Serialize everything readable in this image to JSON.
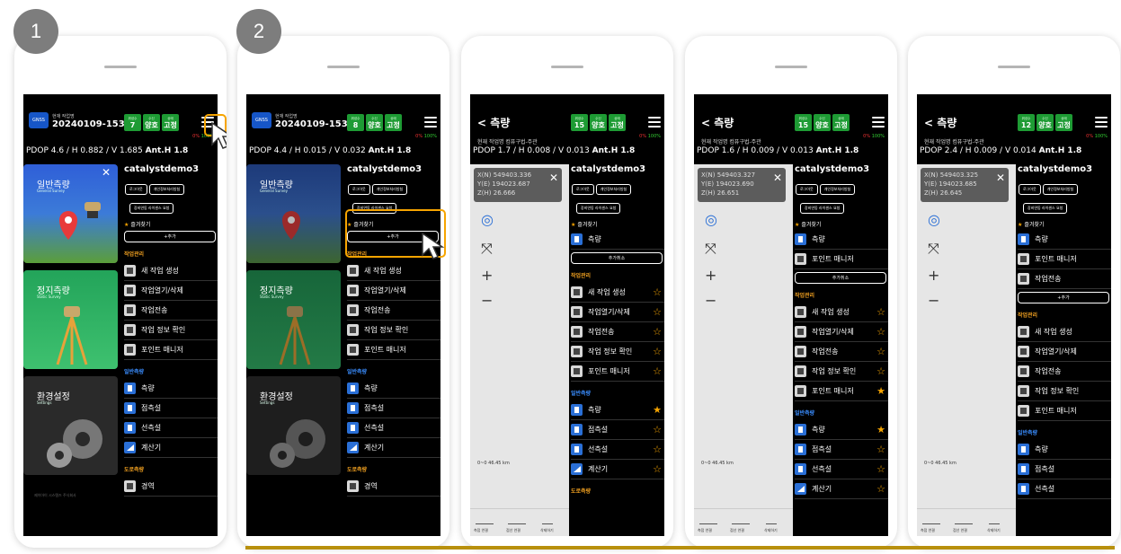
{
  "steps": [
    "1",
    "2"
  ],
  "status": {
    "badge_labels": [
      "위성수",
      "수신",
      "상태"
    ],
    "pdop_prefix": "PDOP",
    "anth_label": "Ant.H",
    "battery": "0%",
    "storage": "100%"
  },
  "phone1": {
    "work_label": "현재 작업명",
    "work_id": "20240109-153",
    "badges": [
      "7",
      "양호",
      "고정"
    ],
    "pdop": "PDOP 4.6 / H 0.882 / V 1.685",
    "anth": "Ant.H 1.8",
    "account": "catalystdemo3",
    "btns": [
      "로그아웃",
      "개인정보처리방침",
      "장비연동 라이센스 요청"
    ],
    "fav_title": "즐겨찾기",
    "fav_add": "+추가",
    "sec_work": "작업관리",
    "work_items": [
      "새 작업 생성",
      "작업열기/삭제",
      "작업전송",
      "작업 정보 확인",
      "포인트 매니저"
    ],
    "sec_general": "일반측량",
    "general_items": [
      "측량",
      "점측설",
      "선측설",
      "계산기"
    ],
    "sec_road": "도로측량",
    "road_items": [
      "경역"
    ],
    "tiles": [
      {
        "title": "일반측량",
        "sub": "General Survey"
      },
      {
        "title": "정지측량",
        "sub": "Static Survey"
      },
      {
        "title": "환경설정",
        "sub": "Settings"
      }
    ],
    "footer_note": "제이아이 시스템즈 주식회사"
  },
  "phone2": {
    "work_label": "현재 작업명",
    "work_id": "20240109-153",
    "badges": [
      "8",
      "양호",
      "고정"
    ],
    "pdop": "PDOP 4.4 / H 0.015 / V 0.032",
    "anth": "Ant.H 1.8",
    "account": "catalystdemo3",
    "btns": [
      "로그아웃",
      "개인정보처리방침",
      "장비연동 라이센스 요청"
    ],
    "fav_title": "즐겨찾기",
    "fav_add": "+추가",
    "sec_work": "작업관리",
    "work_items": [
      "새 작업 생성",
      "작업열기/삭제",
      "작업전송",
      "작업 정보 확인",
      "포인트 매니저"
    ],
    "sec_general": "일반측량",
    "general_items": [
      "측량",
      "점측설",
      "선측설",
      "계산기"
    ],
    "sec_road": "도로측량",
    "road_items": [
      "경역"
    ],
    "tiles": [
      {
        "title": "일반측량",
        "sub": "General Survey"
      },
      {
        "title": "정지측량",
        "sub": "Static Survey"
      },
      {
        "title": "환경설정",
        "sub": "Settings"
      }
    ]
  },
  "phone3": {
    "back": "< 측량",
    "sub": "현재 작업명 컴퓨구법-주관",
    "badges": [
      "15",
      "양호",
      "고정"
    ],
    "pdop": "PDOP 1.7 / H 0.008 / V 0.013",
    "anth": "Ant.H 1.8",
    "coords": [
      "X(N) 549403.336",
      "Y(E) 194023.687",
      "Z(H) 26.666"
    ],
    "account": "catalystdemo3",
    "btns": [
      "로그아웃",
      "개인정보처리방침",
      "장비연동 라이센스 요청"
    ],
    "fav_title": "즐겨찾기",
    "fav_items": [
      "측량"
    ],
    "fav_remove": "추가취소",
    "sec_work": "작업관리",
    "work_items": [
      "새 작업 생성",
      "작업열기/삭제",
      "작업전송",
      "작업 정보 확인",
      "포인트 매니저"
    ],
    "sec_general": "일반측량",
    "general_items": [
      "측량",
      "점측설",
      "선측설",
      "계산기"
    ],
    "sec_road": "도로측량",
    "scale": "0~0 46.45 km",
    "map_bar": [
      "측점 연결",
      "점선 연결",
      "삭제하기"
    ]
  },
  "phone4": {
    "back": "< 측량",
    "sub": "현재 작업명 컴퓨구법-주관",
    "badges": [
      "15",
      "양호",
      "고정"
    ],
    "pdop": "PDOP 1.6 / H 0.009 / V 0.013",
    "anth": "Ant.H 1.8",
    "coords": [
      "X(N) 549403.327",
      "Y(E) 194023.690",
      "Z(H) 26.651"
    ],
    "account": "catalystdemo3",
    "btns": [
      "로그아웃",
      "개인정보처리방침",
      "장비연동 라이센스 요청"
    ],
    "fav_title": "즐겨찾기",
    "fav_items": [
      "측량",
      "포인트 매니저"
    ],
    "fav_remove": "추가취소",
    "sec_work": "작업관리",
    "work_items": [
      "새 작업 생성",
      "작업열기/삭제",
      "작업전송",
      "작업 정보 확인",
      "포인트 매니저"
    ],
    "sec_general": "일반측량",
    "general_items": [
      "측량",
      "점측설",
      "선측설",
      "계산기"
    ],
    "scale": "0~0 46.45 km",
    "map_bar": [
      "측점 연결",
      "점선 연결",
      "삭제하기"
    ]
  },
  "phone5": {
    "back": "< 측량",
    "sub": "현재 작업명 컴퓨구법-주관",
    "badges": [
      "12",
      "양호",
      "고정"
    ],
    "pdop": "PDOP 2.4 / H 0.009 / V 0.014",
    "anth": "Ant.H 1.8",
    "coords": [
      "X(N) 549403.325",
      "Y(E) 194023.685",
      "Z(H) 26.645"
    ],
    "account": "catalystdemo3",
    "btns": [
      "로그아웃",
      "개인정보처리방침",
      "장비연동 라이센스 요청"
    ],
    "fav_title": "즐겨찾기",
    "fav_items": [
      "측량",
      "포인트 매니저",
      "작업전송"
    ],
    "fav_add": "+추가",
    "sec_work": "작업관리",
    "work_items": [
      "새 작업 생성",
      "작업열기/삭제",
      "작업전송",
      "작업 정보 확인",
      "포인트 매니저"
    ],
    "sec_general": "일반측량",
    "general_items": [
      "측량",
      "점측설",
      "선측설"
    ],
    "scale": "0~0 46.45 km",
    "map_bar": [
      "측점 연결",
      "점선 연결",
      "삭제하기"
    ]
  },
  "colors": {
    "accent_gold": "#b8900d",
    "badge_green": "#1e9b34",
    "star": "#f6a400",
    "highlight": "#f6a400"
  }
}
